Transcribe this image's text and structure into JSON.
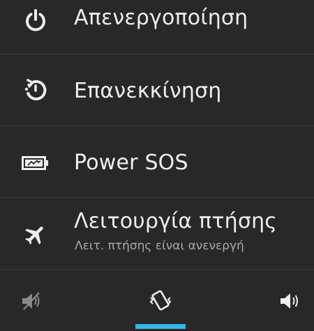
{
  "menu": {
    "items": [
      {
        "label": "Απενεργοποίηση",
        "icon": "power-icon"
      },
      {
        "label": "Επανεκκίνηση",
        "icon": "restart-icon"
      },
      {
        "label": "Power SOS",
        "icon": "battery-sos-icon"
      },
      {
        "label": "Λειτουργία πτήσης",
        "sublabel": "Λειτ. πτήσης είναι ανενεργή",
        "icon": "airplane-icon"
      }
    ]
  },
  "sound_modes": {
    "options": [
      {
        "icon": "silent-icon",
        "selected": false
      },
      {
        "icon": "vibrate-icon",
        "selected": true
      },
      {
        "icon": "sound-on-icon",
        "selected": false
      }
    ]
  },
  "colors": {
    "background": "#282828",
    "text": "#eeeeee",
    "subtext": "#a9a9a9",
    "divider": "#3e3e3e",
    "accent": "#31b6e7"
  }
}
